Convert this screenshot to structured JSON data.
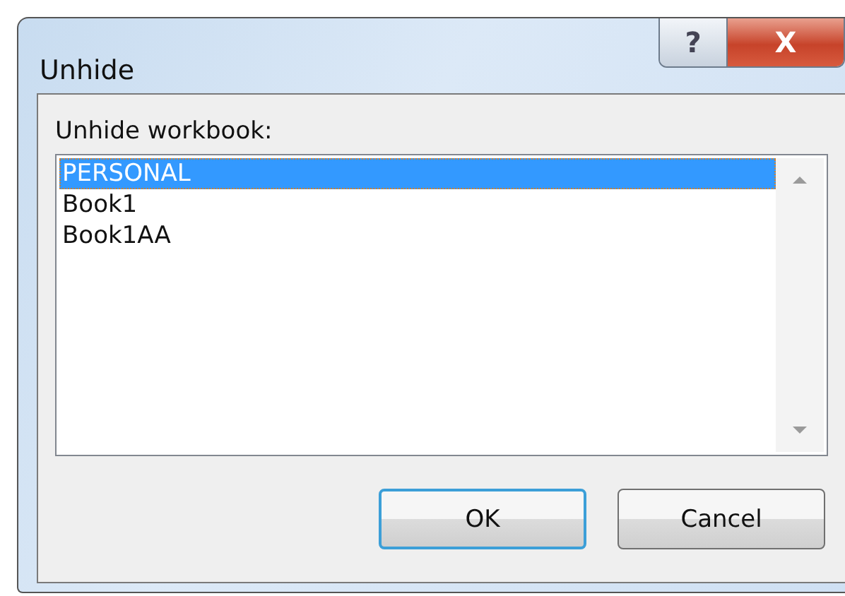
{
  "window": {
    "title": "Unhide",
    "help_button": "?",
    "close_button": "X"
  },
  "list_label": "Unhide workbook:",
  "workbooks": [
    {
      "name": "PERSONAL",
      "selected": true
    },
    {
      "name": "Book1",
      "selected": false
    },
    {
      "name": "Book1AA",
      "selected": false
    }
  ],
  "buttons": [
    {
      "label": "OK",
      "default": true
    },
    {
      "label": "Cancel",
      "default": false
    }
  ]
}
